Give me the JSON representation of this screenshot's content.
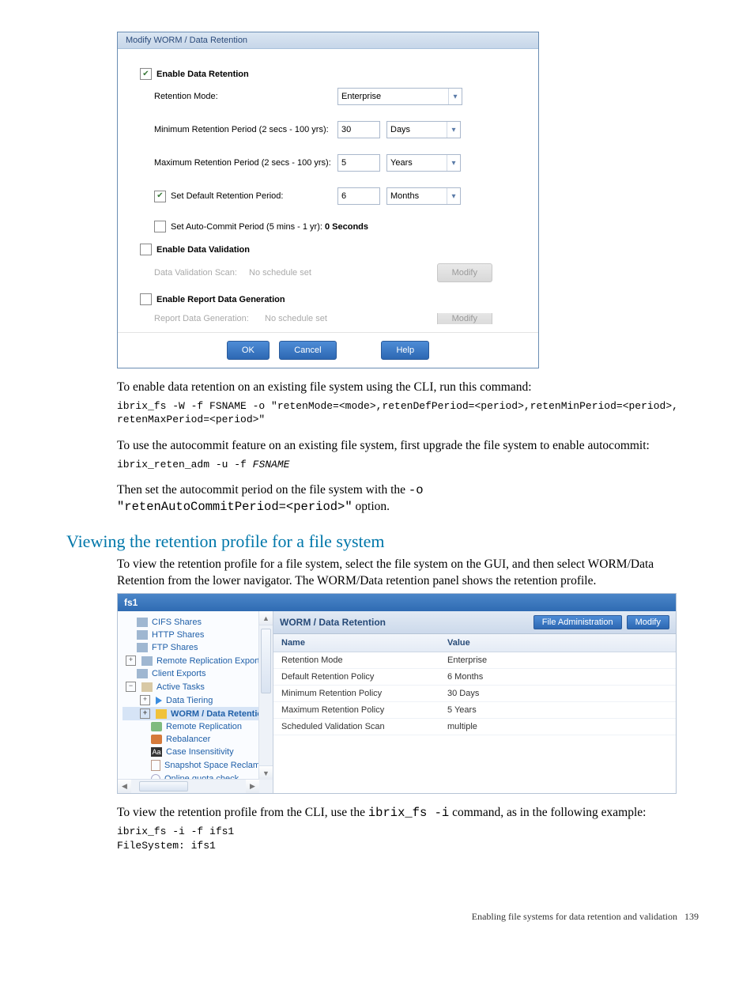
{
  "dialog": {
    "title": "Modify WORM / Data Retention",
    "enable_retention_label": "Enable Data Retention",
    "enable_retention_checked": true,
    "mode_label": "Retention Mode:",
    "mode_value": "Enterprise",
    "min_label": "Minimum Retention Period (2 secs - 100 yrs):",
    "min_value": "30",
    "min_unit": "Days",
    "max_label": "Maximum Retention Period (2 secs - 100 yrs):",
    "max_value": "5",
    "max_unit": "Years",
    "default_label": "Set Default Retention Period:",
    "default_checked": true,
    "default_value": "6",
    "default_unit": "Months",
    "autocommit_label": "Set Auto-Commit Period (5 mins - 1 yr):",
    "autocommit_checked": false,
    "autocommit_display": "0 Seconds",
    "enable_validation_label": "Enable Data Validation",
    "enable_validation_checked": false,
    "validation_scan_label": "Data Validation Scan:",
    "validation_scan_value": "No schedule set",
    "modify1": "Modify",
    "enable_report_label": "Enable Report Data Generation",
    "enable_report_checked": false,
    "report_scan_label": "Report Data Generation:",
    "report_scan_value": "No schedule set",
    "modify2": "Modify",
    "ok": "OK",
    "cancel": "Cancel",
    "help": "Help"
  },
  "body": {
    "p1": "To enable data retention on an existing file system using the CLI, run this command:",
    "code1": "ibrix_fs -W -f FSNAME -o \"retenMode=<mode>,retenDefPeriod=<period>,retenMinPeriod=<period>,\nretenMaxPeriod=<period>\"",
    "p2": "To use the autocommit feature on an existing file system, first upgrade the file system to enable autocommit:",
    "code2_pre": "ibrix_reten_adm -u -f ",
    "code2_var": "FSNAME",
    "p3_a": "Then set the autocommit period on the file system with the ",
    "p3_code1": "-o",
    "p3_code2": "\"retenAutoCommitPeriod=<period>\"",
    "p3_b": " option.",
    "h2": "Viewing the retention profile for a file system",
    "p4": "To view the retention profile for a file system, select the file system on the GUI, and then select WORM/Data Retention from the lower navigator. The WORM/Data retention panel shows the retention profile.",
    "p5_a": "To view the retention profile from the CLI, use the ",
    "p5_code": "ibrix_fs -i",
    "p5_b": " command, as in the following example:",
    "code_ex": "ibrix_fs -i -f ifs1\nFileSystem: ifs1"
  },
  "panel": {
    "fs_name": "fs1",
    "nav": {
      "items": [
        "CIFS Shares",
        "HTTP Shares",
        "FTP Shares",
        "Remote Replication Exports",
        "Client Exports",
        "Active Tasks",
        "Data Tiering",
        "WORM / Data Retention",
        "Remote Replication",
        "Rebalancer",
        "Case Insensitivity",
        "Snapshot Space Reclama",
        "Online quota check"
      ]
    },
    "right_title": "WORM / Data Retention",
    "btn_file_admin": "File Administration",
    "btn_modify": "Modify",
    "col_name": "Name",
    "col_value": "Value",
    "rows": [
      {
        "n": "Retention Mode",
        "v": "Enterprise"
      },
      {
        "n": "Default Retention Policy",
        "v": "6 Months"
      },
      {
        "n": "Minimum Retention Policy",
        "v": "30 Days"
      },
      {
        "n": "Maximum Retention Policy",
        "v": "5 Years"
      },
      {
        "n": "Scheduled Validation Scan",
        "v": "multiple"
      }
    ]
  },
  "footer": {
    "text": "Enabling file systems for data retention and validation",
    "page": "139"
  }
}
